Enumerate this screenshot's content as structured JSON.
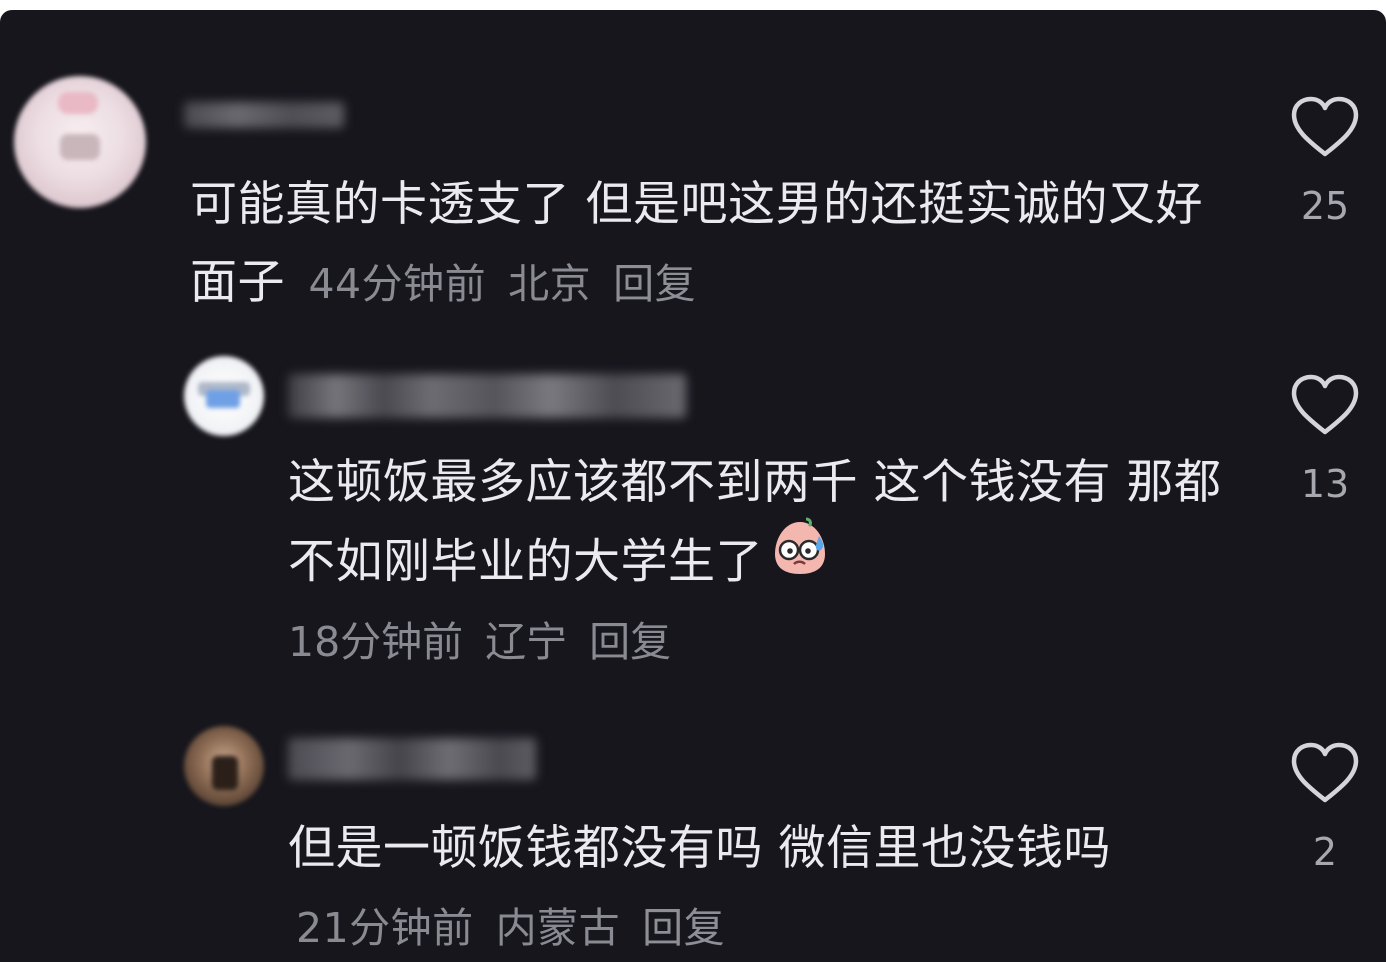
{
  "colors": {
    "background": "#17161d",
    "text": "#ebebef",
    "meta": "#8a8a93",
    "like_icon": "#d4d4da"
  },
  "comments": [
    {
      "text": "可能真的卡透支了 但是吧这男的还挺实诚的又好面子",
      "time": "44分钟前",
      "location": "北京",
      "reply_label": "回复",
      "like_count": "25",
      "like_icon": "heart-outline-icon"
    },
    {
      "text": "这顿饭最多应该都不到两千 这个钱没有 那都不如刚毕业的大学生了",
      "emoji": "sweating-face-emoji-icon",
      "time": "18分钟前",
      "location": "辽宁",
      "reply_label": "回复",
      "like_count": "13",
      "like_icon": "heart-outline-icon"
    },
    {
      "text": "但是一顿饭钱都没有吗 微信里也没钱吗",
      "time": "21分钟前",
      "location": "内蒙古",
      "reply_label": "回复",
      "like_count": "2",
      "like_icon": "heart-outline-icon"
    }
  ]
}
